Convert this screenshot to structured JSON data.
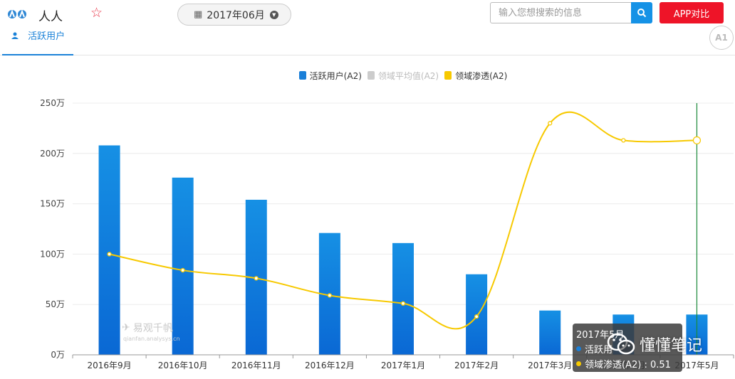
{
  "header": {
    "app_name": "人人",
    "date_label": "2017年06月",
    "search_placeholder": "输入您想搜索的信息",
    "compare_label": "APP对比"
  },
  "tabs": {
    "active_label": "活跃用户",
    "badge": "A1"
  },
  "legend": [
    {
      "label": "活跃用户(A2)",
      "color": "#1a7fd8",
      "active": true
    },
    {
      "label": "领域平均值(A2)",
      "color": "#cccccc",
      "active": false
    },
    {
      "label": "领域渗透(A2)",
      "color": "#f7c900",
      "active": true
    }
  ],
  "chart_data": {
    "type": "bar",
    "categories": [
      "2016年9月",
      "2016年10月",
      "2016年11月",
      "2016年12月",
      "2017年1月",
      "2017年2月",
      "2017年3月",
      "2017年4月",
      "2017年5月"
    ],
    "series": [
      {
        "name": "活跃用户(A2)",
        "type": "bar",
        "values": [
          208,
          176,
          154,
          121,
          111,
          80,
          44,
          40,
          40
        ]
      },
      {
        "name": "领域渗透(A2)",
        "type": "line",
        "values": [
          100,
          84,
          76,
          59,
          51,
          38,
          230,
          213,
          213
        ]
      }
    ],
    "ylim": [
      0,
      250
    ],
    "yticks": [
      "0万",
      "50万",
      "100万",
      "150万",
      "200万",
      "250万"
    ],
    "grid": true,
    "legend_position": "top",
    "colors": {
      "bar_top": "#1690e4",
      "bar_bottom": "#0a68d4",
      "line": "#f7c900",
      "cursor": "#1a8a3a"
    },
    "highlighted_category": "2017年5月"
  },
  "tooltip": {
    "title": "2017年5月",
    "row1_label": "活跃用",
    "row2_label": "领域渗透(A2) : 0.51",
    "row1_color": "#1a7fd8",
    "row2_color": "#f7c900"
  },
  "wechat_label": "懂懂笔记",
  "watermark": {
    "main": "易观千帆",
    "sub": "qianfan.analysys.cn"
  }
}
